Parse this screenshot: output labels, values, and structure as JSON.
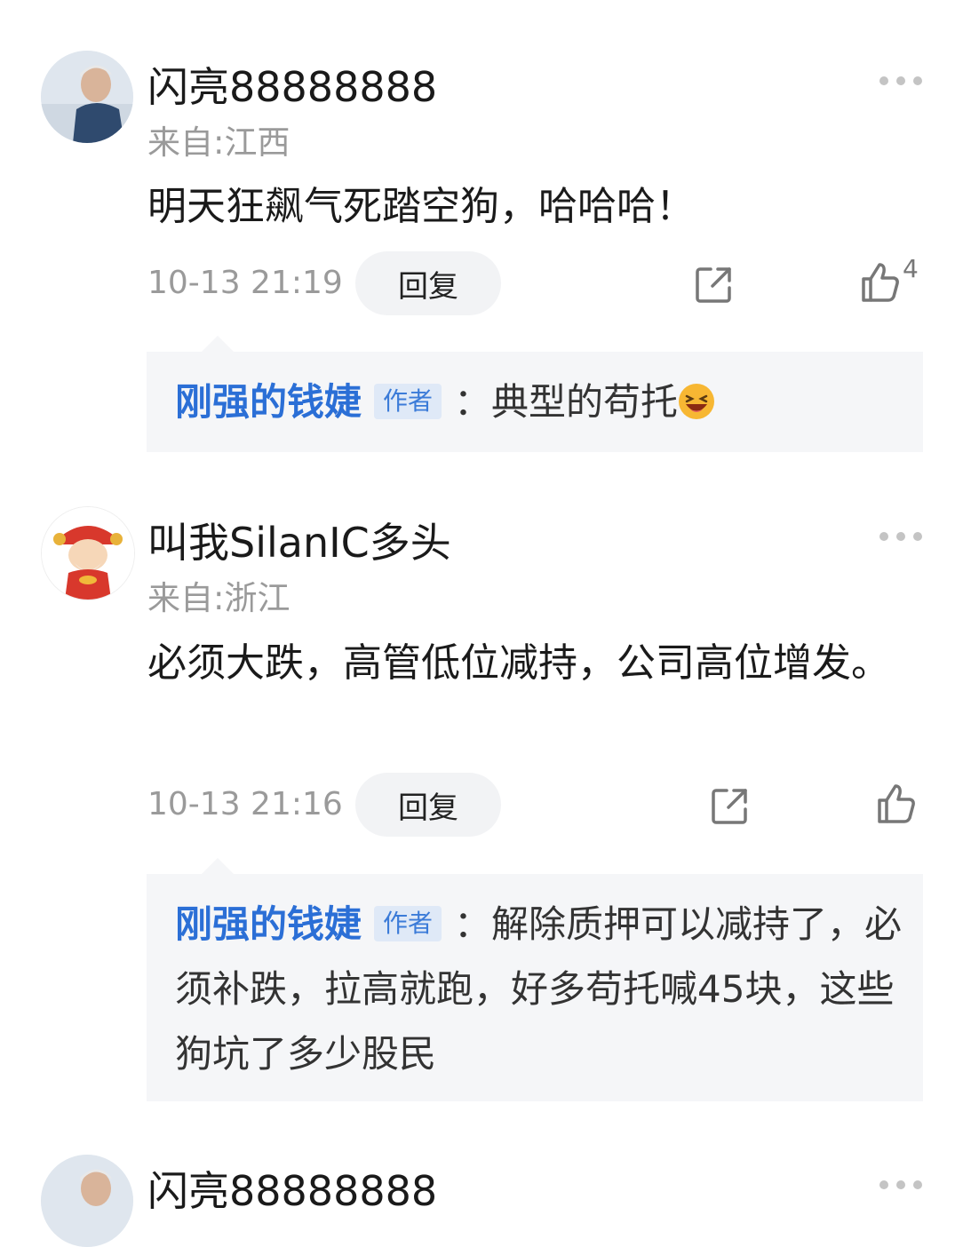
{
  "comments": [
    {
      "username": "闪亮88888888",
      "location": "来自:江西",
      "content": "明天狂飙气死踏空狗，哈哈哈！",
      "time": "10-13 21:19",
      "reply_label": "回复",
      "like_count": "4",
      "reply": {
        "author": "刚强的钱婕",
        "tag": "作者",
        "text": "：典型的苟托"
      }
    },
    {
      "username": "叫我SilanIC多头",
      "location": "来自:浙江",
      "content": "必须大跌，高管低位减持，公司高位增发。",
      "time": "10-13 21:16",
      "reply_label": "回复",
      "like_count": "",
      "reply": {
        "author": "刚强的钱婕",
        "tag": "作者",
        "text": "：解除质押可以减持了，必须补跌，拉高就跑，好多苟托喊45块，这些狗坑了多少股民"
      }
    },
    {
      "username": "闪亮88888888"
    }
  ],
  "icons": {
    "more": "more-dots-icon",
    "share": "share-icon",
    "like": "thumbs-up-icon",
    "emoji": "laughing-emoji-icon"
  },
  "colors": {
    "author_blue": "#2b6fd6",
    "tag_bg": "#dfe9f7",
    "reply_bg": "#f5f6f8",
    "muted_gray": "#9a9a9a"
  }
}
